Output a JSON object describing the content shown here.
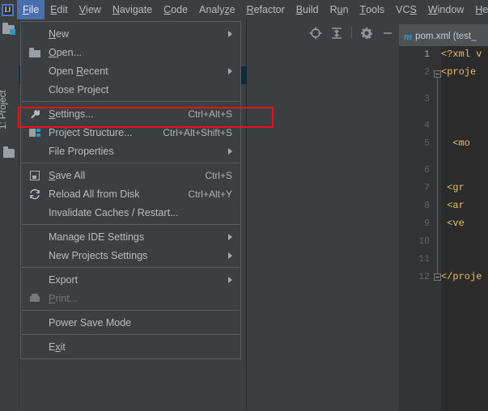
{
  "menubar": {
    "logo_text": "IJ",
    "items": [
      {
        "label": "File",
        "mnemonic": "F",
        "active": true
      },
      {
        "label": "Edit",
        "mnemonic": "E",
        "active": false
      },
      {
        "label": "View",
        "mnemonic": "V",
        "active": false
      },
      {
        "label": "Navigate",
        "mnemonic": "N",
        "active": false
      },
      {
        "label": "Code",
        "mnemonic": "C",
        "active": false
      },
      {
        "label": "Analyze",
        "mnemonic": "z",
        "active": false
      },
      {
        "label": "Refactor",
        "mnemonic": "R",
        "active": false
      },
      {
        "label": "Build",
        "mnemonic": "B",
        "active": false
      },
      {
        "label": "Run",
        "mnemonic": "u",
        "active": false
      },
      {
        "label": "Tools",
        "mnemonic": "T",
        "active": false
      },
      {
        "label": "VCS",
        "mnemonic": "S",
        "active": false
      },
      {
        "label": "Window",
        "mnemonic": "W",
        "active": false
      },
      {
        "label": "Help",
        "mnemonic": "H",
        "active": false
      }
    ]
  },
  "sidebar": {
    "project_tab_label": "1: Project"
  },
  "toolbar": {
    "icons": [
      "locate-icon",
      "collapse-all-icon",
      "settings-gear-icon",
      "minimize-icon"
    ]
  },
  "editor": {
    "tab_label": "pom.xml (test_",
    "tab_icon": "maven-m-icon",
    "line_numbers": [
      "1",
      "2",
      "3",
      "4",
      "5",
      "6",
      "7",
      "8",
      "9",
      "10",
      "11",
      "12"
    ],
    "current_line": 1,
    "code_lines": [
      {
        "n": 1,
        "text": "<?xml v"
      },
      {
        "n": 2,
        "text": "<proje"
      },
      {
        "n": 3,
        "text": ""
      },
      {
        "n": 4,
        "text": ""
      },
      {
        "n": 5,
        "text": "  <mo"
      },
      {
        "n": 6,
        "text": ""
      },
      {
        "n": 7,
        "text": " <gr"
      },
      {
        "n": 8,
        "text": " <ar"
      },
      {
        "n": 9,
        "text": " <ve"
      },
      {
        "n": 10,
        "text": ""
      },
      {
        "n": 11,
        "text": ""
      },
      {
        "n": 12,
        "text": "</proje"
      }
    ]
  },
  "file_menu": {
    "items": [
      {
        "label": "New",
        "mnemonic": "N",
        "accel": "",
        "submenu": true,
        "icon": "",
        "disabled": false
      },
      {
        "label": "Open...",
        "mnemonic": "O",
        "accel": "",
        "submenu": false,
        "icon": "folder-icon",
        "disabled": false
      },
      {
        "label": "Open Recent",
        "mnemonic": "R",
        "accel": "",
        "submenu": true,
        "icon": "",
        "disabled": false
      },
      {
        "label": "Close Project",
        "mnemonic": "",
        "accel": "",
        "submenu": false,
        "icon": "",
        "disabled": false
      },
      {
        "separator": true
      },
      {
        "label": "Settings...",
        "mnemonic": "S",
        "accel": "Ctrl+Alt+S",
        "submenu": false,
        "icon": "wrench-icon",
        "disabled": false
      },
      {
        "label": "Project Structure...",
        "mnemonic": "",
        "accel": "Ctrl+Alt+Shift+S",
        "submenu": false,
        "icon": "module-icon",
        "disabled": false,
        "highlighted": true
      },
      {
        "label": "File Properties",
        "mnemonic": "",
        "accel": "",
        "submenu": true,
        "icon": "",
        "disabled": false
      },
      {
        "separator": true
      },
      {
        "label": "Save All",
        "mnemonic": "S",
        "accel": "Ctrl+S",
        "submenu": false,
        "icon": "floppy-save-icon",
        "disabled": false
      },
      {
        "label": "Reload All from Disk",
        "mnemonic": "",
        "accel": "Ctrl+Alt+Y",
        "submenu": false,
        "icon": "reload-icon",
        "disabled": false
      },
      {
        "label": "Invalidate Caches / Restart...",
        "mnemonic": "",
        "accel": "",
        "submenu": false,
        "icon": "",
        "disabled": false
      },
      {
        "separator": true
      },
      {
        "label": "Manage IDE Settings",
        "mnemonic": "",
        "accel": "",
        "submenu": true,
        "icon": "",
        "disabled": false
      },
      {
        "label": "New Projects Settings",
        "mnemonic": "",
        "accel": "",
        "submenu": true,
        "icon": "",
        "disabled": false
      },
      {
        "separator": true
      },
      {
        "label": "Export",
        "mnemonic": "",
        "accel": "",
        "submenu": true,
        "icon": "",
        "disabled": false
      },
      {
        "label": "Print...",
        "mnemonic": "P",
        "accel": "",
        "submenu": false,
        "icon": "printer-icon",
        "disabled": true
      },
      {
        "separator": true
      },
      {
        "label": "Power Save Mode",
        "mnemonic": "",
        "accel": "",
        "submenu": false,
        "icon": "",
        "disabled": false
      },
      {
        "separator": true
      },
      {
        "label": "Exit",
        "mnemonic": "x",
        "accel": "",
        "submenu": false,
        "icon": "",
        "disabled": false
      }
    ]
  },
  "annotation": {
    "type": "red-rectangle-highlight",
    "target": "Project Structure...",
    "color": "#ee1111"
  },
  "colors": {
    "background": "#3c3f41",
    "editor_background": "#2b2b2b",
    "menu_active": "#4b6eaf",
    "accent_blue": "#3592c4",
    "xml_tag": "#e8bf6a",
    "selection_navy": "#0d293e"
  }
}
